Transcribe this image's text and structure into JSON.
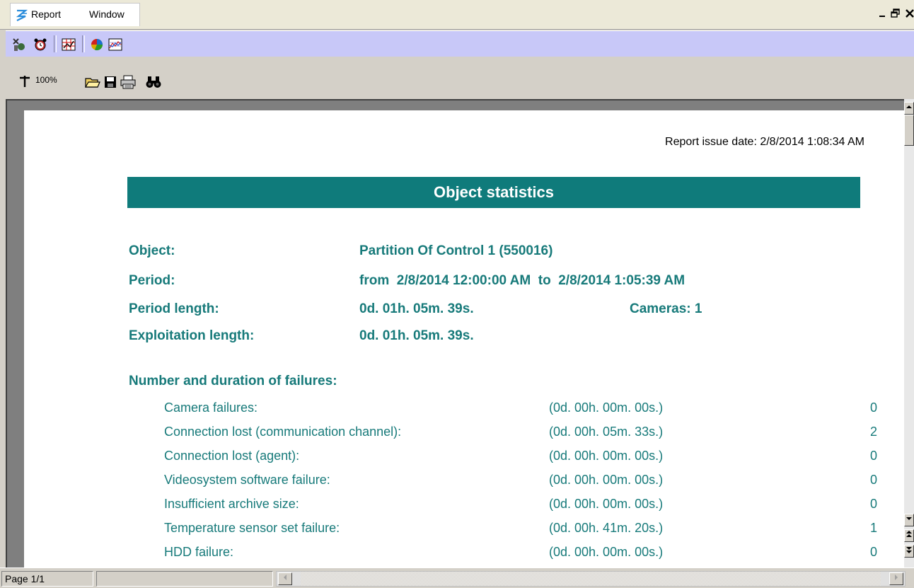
{
  "menu": {
    "items": [
      "Report",
      "Window"
    ]
  },
  "window_controls": {
    "minimize": "_",
    "restore": "Ñ",
    "close": "×"
  },
  "toolbar2": {
    "zoom_label": "100%"
  },
  "report": {
    "issue_date": "Report issue date: 2/8/2014 1:08:34 AM",
    "title": "Object statistics",
    "object_label": "Object:",
    "object_value": "Partition Of Control 1 (550016)",
    "period_label": "Period:",
    "period_value": "from  2/8/2014 12:00:00 AM  to  2/8/2014 1:05:39 AM",
    "period_length_label": "Period length:",
    "period_length_value": "0d. 01h. 05m. 39s.",
    "cameras": "Cameras: 1",
    "exploitation_label": "Exploitation length:",
    "exploitation_value": "0d. 01h. 05m. 39s.",
    "failures_heading": "Number and duration of failures:",
    "failures": [
      {
        "label": "Camera failures:",
        "duration": "(0d. 00h. 00m. 00s.)",
        "count": "0"
      },
      {
        "label": "Connection lost (communication channel):",
        "duration": "(0d. 00h. 05m. 33s.)",
        "count": "2"
      },
      {
        "label": "Connection lost (agent):",
        "duration": "(0d. 00h. 00m. 00s.)",
        "count": "0"
      },
      {
        "label": "Videosystem software failure:",
        "duration": "(0d. 00h. 00m. 00s.)",
        "count": "0"
      },
      {
        "label": "Insufficient archive size:",
        "duration": "(0d. 00h. 00m. 00s.)",
        "count": "0"
      },
      {
        "label": "Temperature sensor set failure:",
        "duration": "(0d. 00h. 41m. 20s.)",
        "count": "1"
      },
      {
        "label": "HDD failure:",
        "duration": "(0d. 00h. 00m. 00s.)",
        "count": "0"
      }
    ]
  },
  "status": {
    "page": "Page 1/1"
  },
  "colors": {
    "teal_text": "#177a7a",
    "title_bar": "#0f7b7b",
    "toolbar1_bg": "#c8c8f8"
  }
}
